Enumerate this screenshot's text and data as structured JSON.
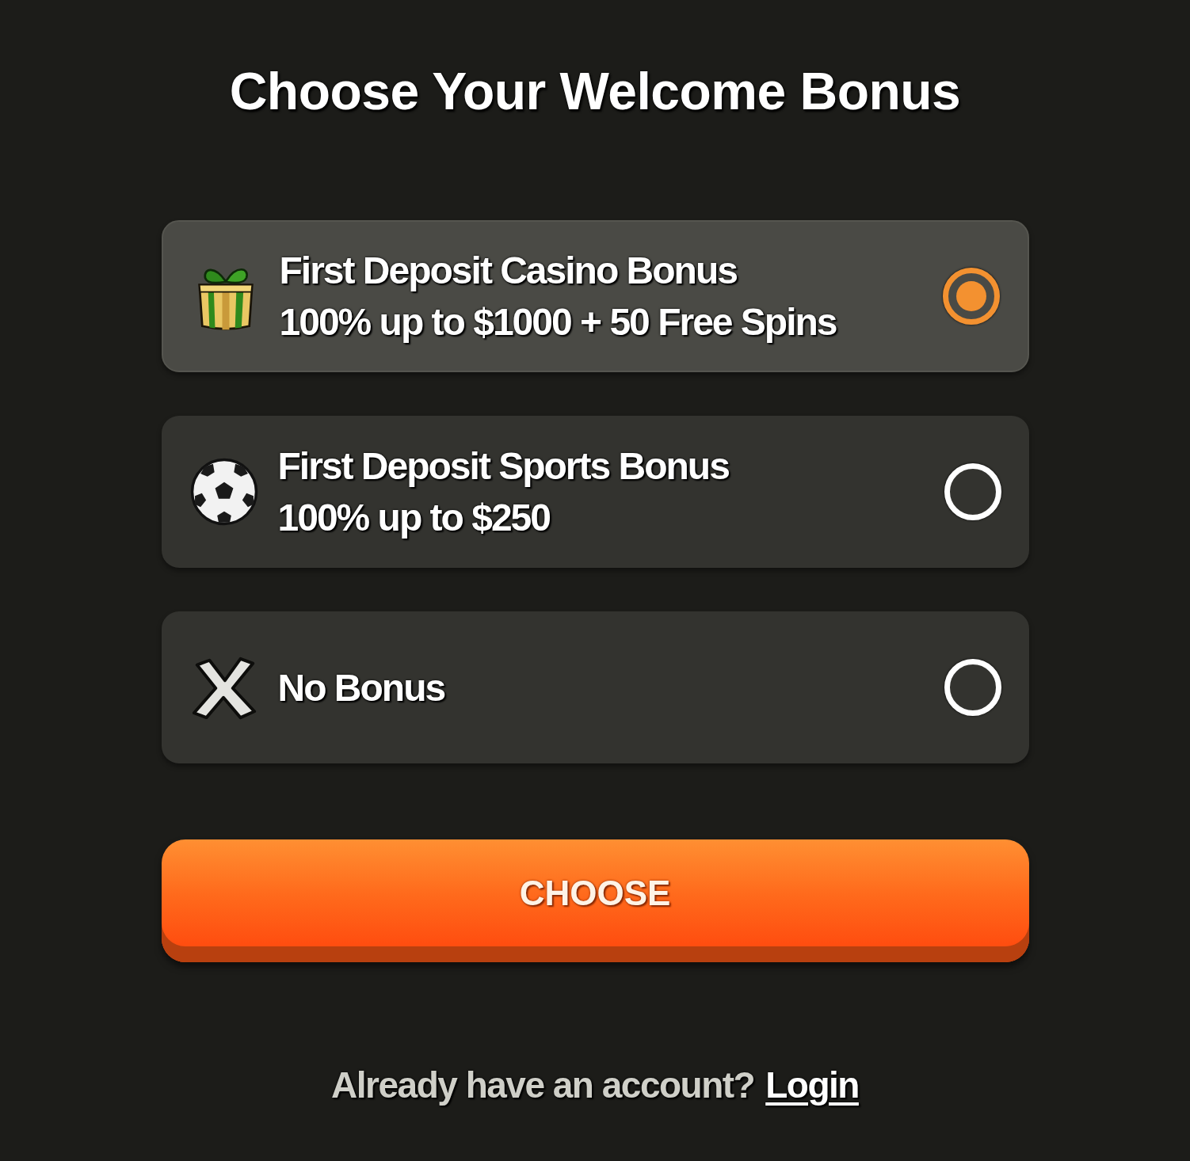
{
  "title": "Choose Your Welcome Bonus",
  "options": [
    {
      "kind": "casino",
      "title": "First Deposit Casino Bonus",
      "detail": "100% up to $1000 + 50 Free Spins",
      "selected": true
    },
    {
      "kind": "sports",
      "title": "First Deposit Sports Bonus",
      "detail": "100% up to $250",
      "selected": false
    },
    {
      "kind": "none",
      "title": "No Bonus",
      "selected": false
    }
  ],
  "choose_button": {
    "label": "CHOOSE"
  },
  "footer": {
    "prompt": "Already have an account?",
    "link": "Login"
  }
}
